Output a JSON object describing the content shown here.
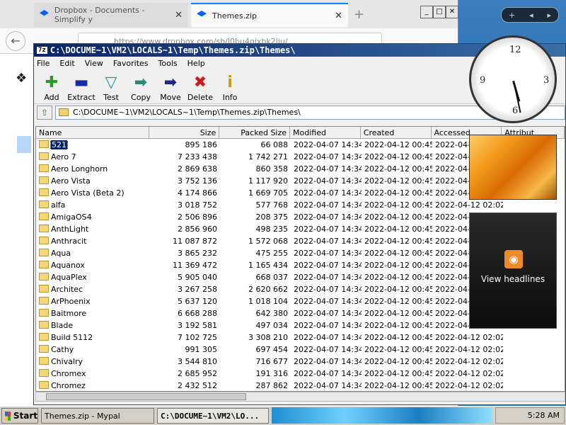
{
  "firefox": {
    "tabs": [
      {
        "label": "Dropbox - Documents - Simplify y"
      },
      {
        "label": "Themes.zip"
      }
    ],
    "url": "https://www.dropbox.com/sh/l0bu4gjxbk2liu/..."
  },
  "zip": {
    "title": "C:\\DOCUME~1\\VM2\\LOCALS~1\\Temp\\Themes.zip\\Themes\\",
    "menu": [
      "File",
      "Edit",
      "View",
      "Favorites",
      "Tools",
      "Help"
    ],
    "toolbar": [
      {
        "label": "Add",
        "icon": "plus-icon"
      },
      {
        "label": "Extract",
        "icon": "minus-icon"
      },
      {
        "label": "Test",
        "icon": "check-icon"
      },
      {
        "label": "Copy",
        "icon": "copy-arrow-icon"
      },
      {
        "label": "Move",
        "icon": "move-arrow-icon"
      },
      {
        "label": "Delete",
        "icon": "delete-x-icon"
      },
      {
        "label": "Info",
        "icon": "info-icon"
      }
    ],
    "address": "C:\\DOCUME~1\\VM2\\LOCALS~1\\Temp\\Themes.zip\\Themes\\",
    "columns": [
      "Name",
      "Size",
      "Packed Size",
      "Modified",
      "Created",
      "Accessed",
      "Attribut"
    ],
    "rows": [
      [
        "521",
        "895 186",
        "66 088",
        "2022-04-07 14:34",
        "2022-04-12 00:45",
        "2022-04-1"
      ],
      [
        "Aero 7",
        "7 233 438",
        "1 742 271",
        "2022-04-07 14:34",
        "2022-04-12 00:45",
        "2022-04-1"
      ],
      [
        "Aero Longhorn",
        "2 869 638",
        "860 358",
        "2022-04-07 14:34",
        "2022-04-12 00:45",
        "2022-04-1"
      ],
      [
        "Aero Vista",
        "3 752 136",
        "1 117 920",
        "2022-04-07 14:34",
        "2022-04-12 00:45",
        "2022-04-1"
      ],
      [
        "Aero Vista (Beta 2)",
        "4 174 866",
        "1 669 705",
        "2022-04-07 14:34",
        "2022-04-12 00:45",
        "2022-04-1"
      ],
      [
        "alfa",
        "3 018 752",
        "577 768",
        "2022-04-07 14:34",
        "2022-04-12 00:45",
        "2022-04-12 02:02"
      ],
      [
        "AmigaOS4",
        "2 506 896",
        "208 375",
        "2022-04-07 14:34",
        "2022-04-12 00:45",
        "2022-04-1"
      ],
      [
        "AnthLight",
        "2 856 960",
        "498 235",
        "2022-04-07 14:34",
        "2022-04-12 00:45",
        "2022-04-1"
      ],
      [
        "Anthracit",
        "11 087 872",
        "1 572 068",
        "2022-04-07 14:34",
        "2022-04-12 00:45",
        "2022-04-1"
      ],
      [
        "Aqua",
        "3 865 232",
        "475 255",
        "2022-04-07 14:34",
        "2022-04-12 00:45",
        "2022-04-1"
      ],
      [
        "Aquanox",
        "11 369 472",
        "1 165 434",
        "2022-04-07 14:34",
        "2022-04-12 00:45",
        "2022-04-1"
      ],
      [
        "AquaPlex",
        "5 905 040",
        "668 037",
        "2022-04-07 14:34",
        "2022-04-12 00:45",
        "2022-04-1"
      ],
      [
        "Architec",
        "3 267 258",
        "2 620 662",
        "2022-04-07 14:34",
        "2022-04-12 00:45",
        "2022-04-1"
      ],
      [
        "ArPhoenix",
        "5 637 120",
        "1 018 104",
        "2022-04-07 14:34",
        "2022-04-12 00:45",
        "2022-04-1"
      ],
      [
        "Baitmore",
        "6 668 288",
        "642 380",
        "2022-04-07 14:34",
        "2022-04-12 00:45",
        "2022-04-1"
      ],
      [
        "Blade",
        "3 192 581",
        "497 034",
        "2022-04-07 14:34",
        "2022-04-12 00:45",
        "2022-04-1"
      ],
      [
        "Build 5112",
        "7 102 725",
        "3 308 210",
        "2022-04-07 14:34",
        "2022-04-12 00:45",
        "2022-04-12 02:02"
      ],
      [
        "Cathy",
        "991 305",
        "697 454",
        "2022-04-07 14:34",
        "2022-04-12 00:45",
        "2022-04-12 02:02"
      ],
      [
        "Chivalry",
        "3 544 810",
        "716 677",
        "2022-04-07 14:34",
        "2022-04-12 00:45",
        "2022-04-12 02:02"
      ],
      [
        "Chromex",
        "2 685 952",
        "191 316",
        "2022-04-07 14:34",
        "2022-04-12 00:45",
        "2022-04-12 02:02"
      ],
      [
        "Chromez",
        "2 432 512",
        "287 862",
        "2022-04-07 14:34",
        "2022-04-12 00:45",
        "2022-04-12 02:02"
      ]
    ]
  },
  "gadgets": {
    "rss_label": "View headlines",
    "clock_hour": 5,
    "clock_minute": 28
  },
  "taskbar": {
    "start": "Start",
    "tasks": [
      "Themes.zip - Mypal",
      "C:\\DOCUME~1\\VM2\\LO..."
    ],
    "time": "5:28 AM"
  },
  "colors": {
    "titlebar": "#0a246a",
    "selection": "#0a246a"
  }
}
